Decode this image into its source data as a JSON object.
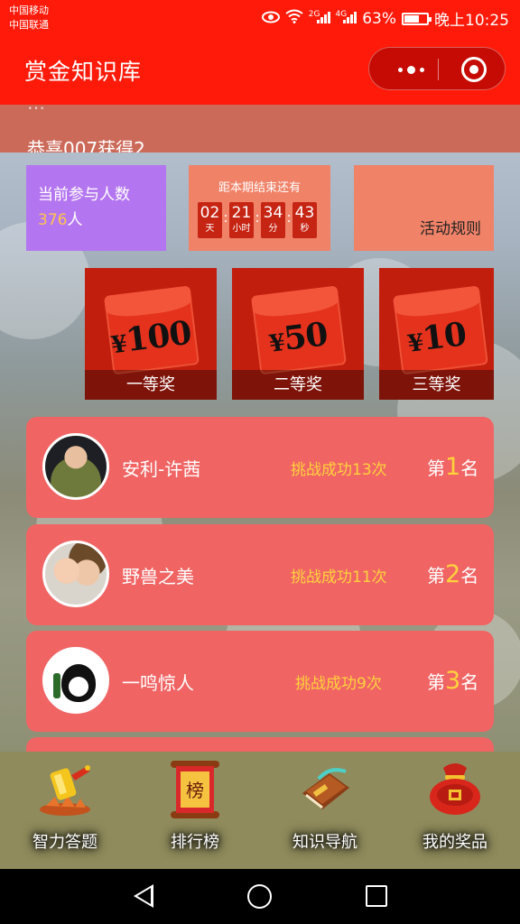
{
  "status_bar": {
    "carrier_1": "中国移动",
    "carrier_2": "中国联通",
    "net_1": "2G",
    "net_2": "4G",
    "battery": "63%",
    "battery_level": 0.63,
    "time": "晚上10:25"
  },
  "navbar": {
    "title": "赏金知识库",
    "bg_color": "#ff1a0a"
  },
  "notice": {
    "partial_text": "…",
    "text": "恭喜007获得2"
  },
  "info": {
    "participants_label": "当前参与人数",
    "participants_count": "376",
    "participants_unit": "人",
    "countdown_label": "距本期结束还有",
    "countdown": [
      {
        "value": "02",
        "unit": "天"
      },
      {
        "value": "21",
        "unit": "小时"
      },
      {
        "value": "34",
        "unit": "分"
      },
      {
        "value": "43",
        "unit": "秒"
      }
    ],
    "rules_label": "活动规则"
  },
  "prizes": [
    {
      "amount": "100",
      "label": "一等奖"
    },
    {
      "amount": "50",
      "label": "二等奖"
    },
    {
      "amount": "10",
      "label": "三等奖"
    }
  ],
  "currency_symbol": "¥",
  "ranking": [
    {
      "name": "安利-许茜",
      "stat": "挑战成功13次",
      "rank_prefix": "第",
      "rank": "1",
      "rank_suffix": "名"
    },
    {
      "name": "野兽之美",
      "stat": "挑战成功11次",
      "rank_prefix": "第",
      "rank": "2",
      "rank_suffix": "名"
    },
    {
      "name": "一鸣惊人",
      "stat": "挑战成功9次",
      "rank_prefix": "第",
      "rank": "3",
      "rank_suffix": "名"
    }
  ],
  "tabbar": [
    {
      "label": "智力答题",
      "icon": "trophy-icon"
    },
    {
      "label": "排行榜",
      "icon": "scroll-icon",
      "icon_text": "榜"
    },
    {
      "label": "知识导航",
      "icon": "book-icon"
    },
    {
      "label": "我的奖品",
      "icon": "lucky-bag-icon"
    }
  ],
  "colors": {
    "accent_red": "#ff1a0a",
    "rank_card": "#f06464",
    "highlight_yellow": "#ffd23c",
    "participants_box": "#b476f0",
    "info_box": "#f08268"
  }
}
